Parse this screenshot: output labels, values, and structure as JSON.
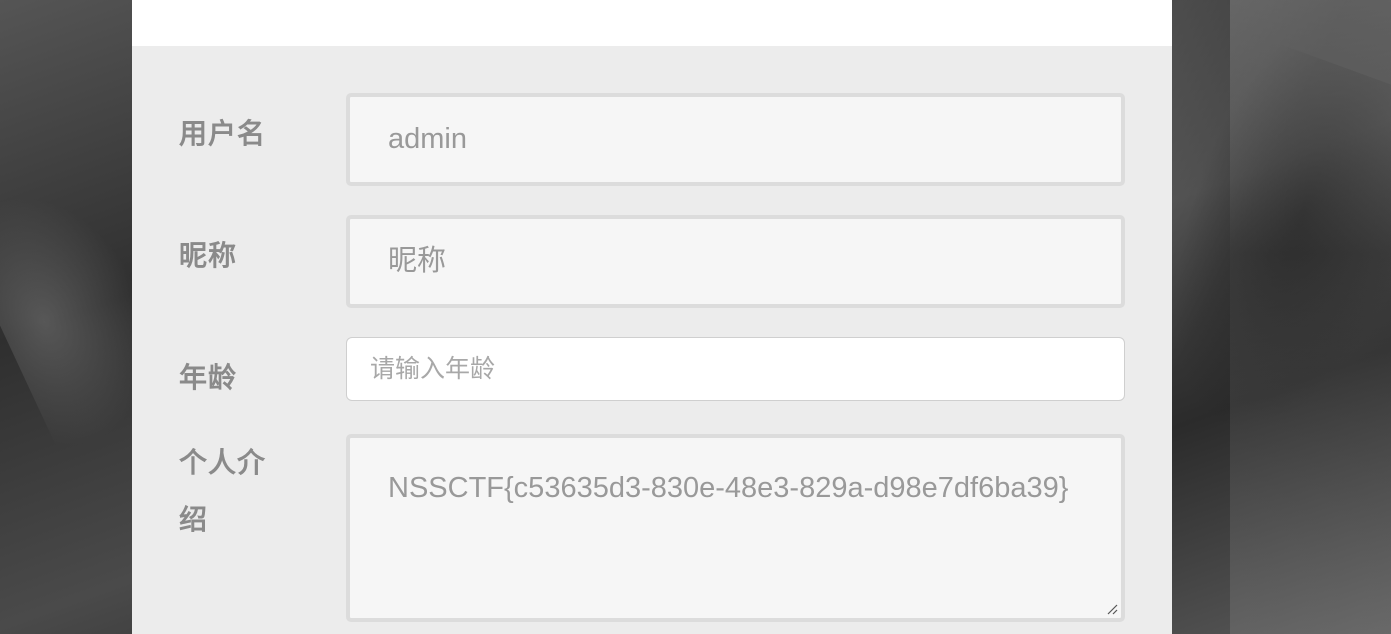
{
  "form": {
    "username": {
      "label": "用户名",
      "value": "admin"
    },
    "nickname": {
      "label": "昵称",
      "value": "昵称"
    },
    "age": {
      "label": "年龄",
      "placeholder": "请输入年龄"
    },
    "bio": {
      "label_line1": "个人介",
      "label_line2": "绍",
      "value": "NSSCTF{c53635d3-830e-48e3-829a-d98e7df6ba39}"
    }
  },
  "icons": {
    "resize": "resize-handle-icon"
  },
  "colors": {
    "panel": "#ececec",
    "label": "#8a8a8a",
    "field_bg": "#f6f6f6",
    "field_border": "#dcdcdc"
  }
}
